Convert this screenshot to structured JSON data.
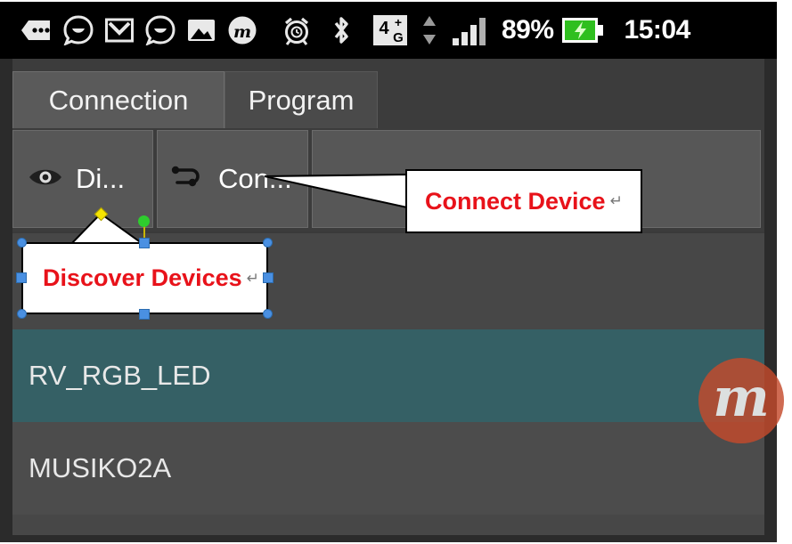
{
  "status_bar": {
    "icons": [
      {
        "name": "sms-bubble-icon",
        "label": "SMS messages"
      },
      {
        "name": "chat-smiley-icon",
        "label": "Chat smiley"
      },
      {
        "name": "gmail-icon",
        "label": "Gmail"
      },
      {
        "name": "chat-smiley-2-icon",
        "label": "Chat smiley 2"
      },
      {
        "name": "photo-gallery-icon",
        "label": "Photo gallery"
      },
      {
        "name": "m-app-icon",
        "label": "m app"
      },
      {
        "name": "alarm-clock-icon",
        "label": "Alarm clock"
      },
      {
        "name": "bluetooth-icon",
        "label": "Bluetooth"
      },
      {
        "name": "network-4g-plus-icon",
        "label": "4G+"
      },
      {
        "name": "data-transfer-arrows-icon",
        "label": "Data transfer"
      },
      {
        "name": "signal-bars-icon",
        "label": "Signal strength"
      }
    ],
    "network_label_main": "4",
    "network_label_plus": "+",
    "network_label_gen": "G",
    "battery_percent": "89%",
    "battery_icon_name": "battery-charging-icon",
    "clock": "15:04"
  },
  "tabs": [
    {
      "label": "Connection",
      "active": true
    },
    {
      "label": "Program",
      "active": false
    }
  ],
  "toolbar": {
    "discover": {
      "label": "Di...",
      "icon": "eye-icon"
    },
    "connect": {
      "label": "Con...",
      "icon": "link-pair-icon"
    },
    "empty_cell_label": ""
  },
  "device_list": {
    "rows": [
      {
        "name": "RV_RGB_LED",
        "selected": true
      },
      {
        "name": "MUSIKO2A",
        "selected": false
      }
    ]
  },
  "watermark": {
    "letter": "m",
    "color": "#c44a2c"
  },
  "annotations": [
    {
      "id": "connect-device",
      "text": "Connect Device",
      "pilcrow": "↵",
      "color": "#e8121a",
      "selected": false
    },
    {
      "id": "discover-devices",
      "text": "Discover Devices",
      "pilcrow": "↵",
      "color": "#e8121a",
      "selected": true
    }
  ],
  "colors": {
    "status_bar_bg": "#000000",
    "app_bg": "#3c3c3c",
    "tab_active_bg": "#5a5a5a",
    "tab_inactive_bg": "#4a4a4a",
    "toolbar_cell_bg": "#575757",
    "row_selected_bg": "#356065",
    "row_normal_bg": "#4c4c4c",
    "annotation_red": "#e8121a",
    "handle_blue": "#4a90e2",
    "handle_yellow": "#f5e400",
    "handle_green": "#2ecc2e"
  }
}
